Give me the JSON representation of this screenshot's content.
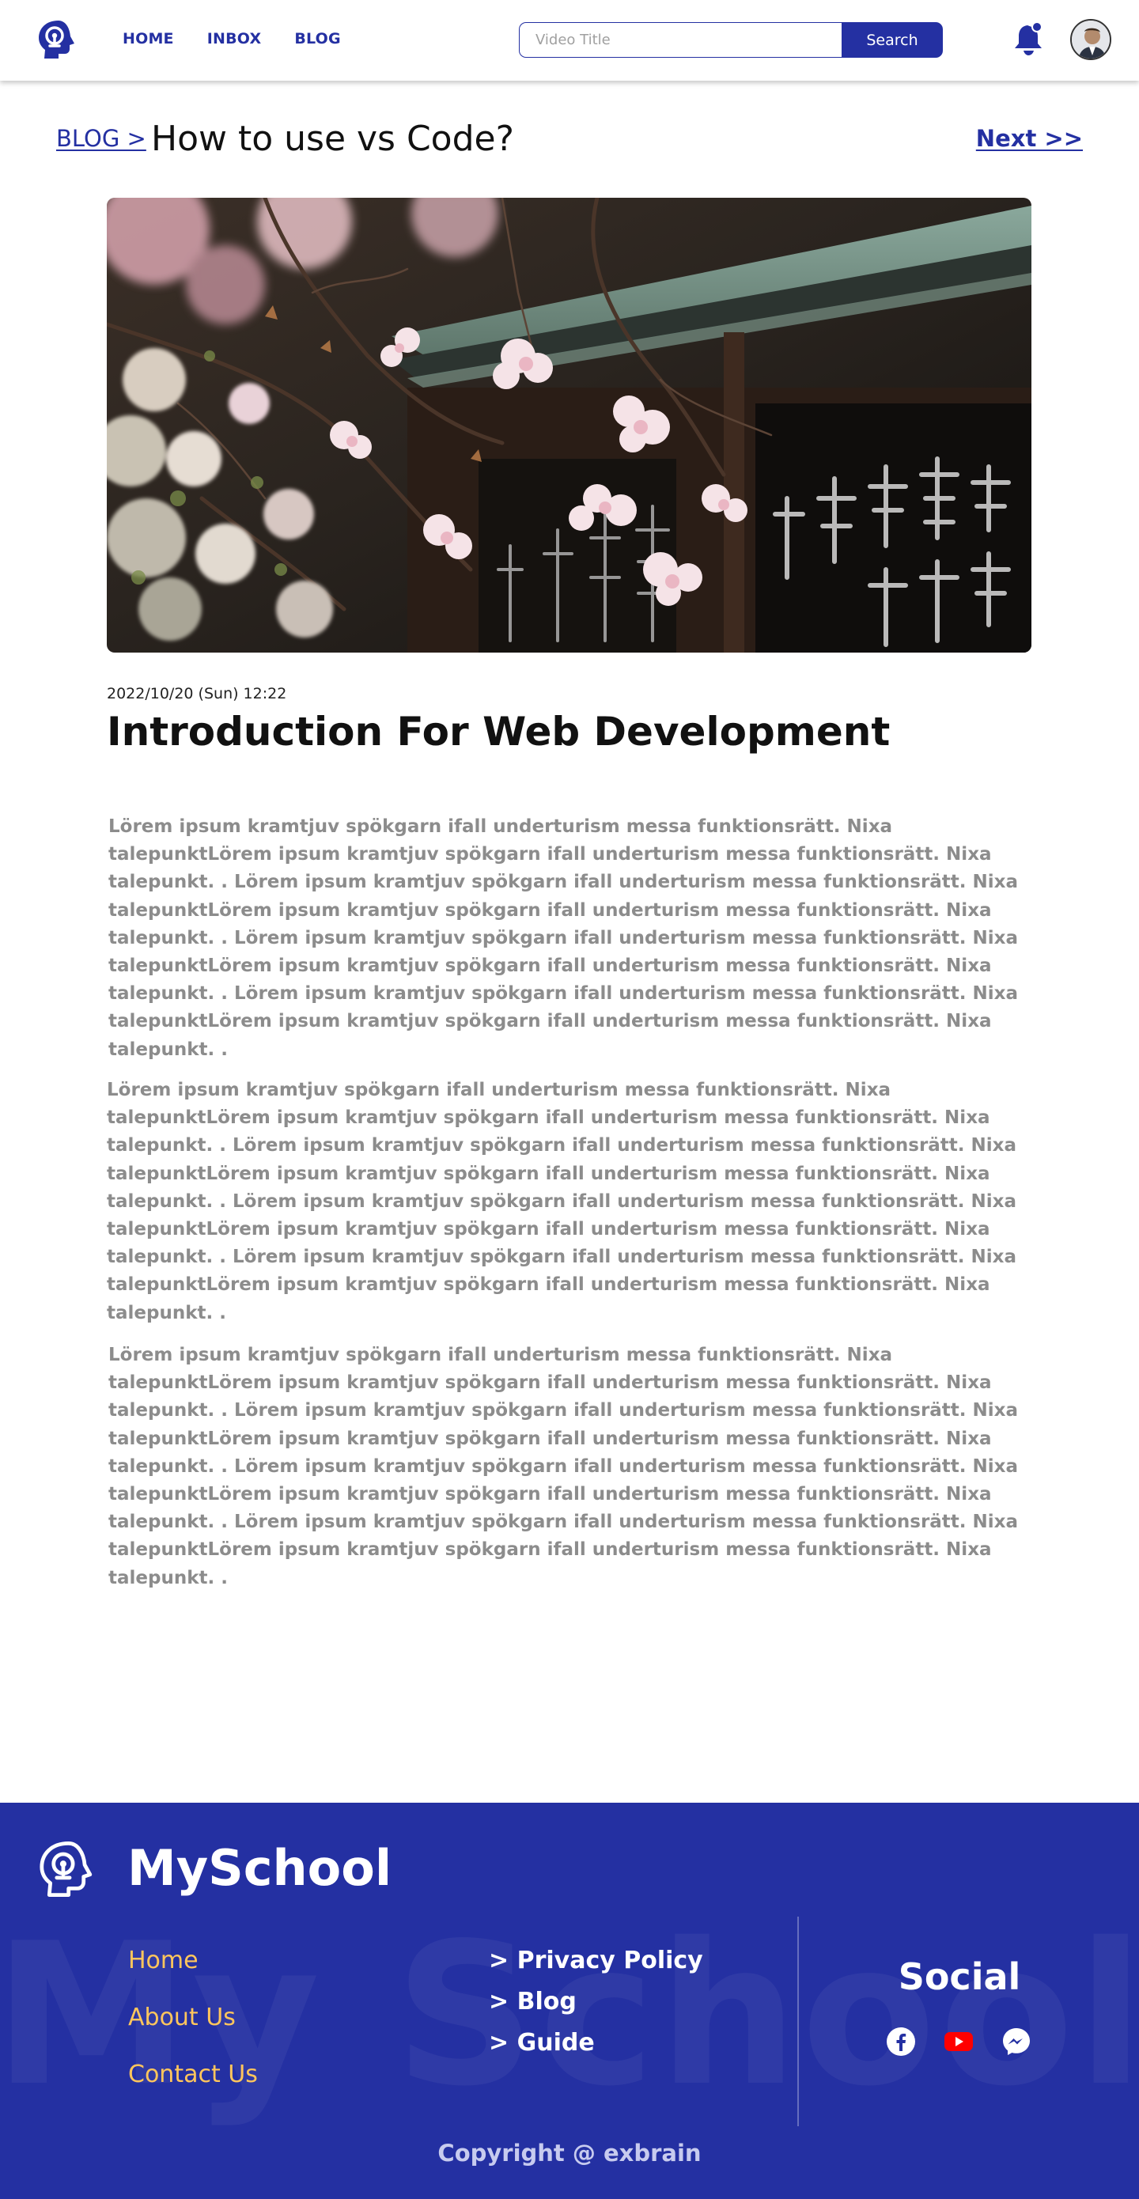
{
  "nav": {
    "links": [
      "HOME",
      "INBOX",
      "BLOG"
    ],
    "search_placeholder": "Video Title",
    "search_label": "Search",
    "colors": {
      "brand": "#2430a2",
      "accent": "#ffc65c"
    }
  },
  "header": {
    "breadcrumb": "BLOG >",
    "title": "How to use vs Code?",
    "next": "Next >>"
  },
  "article": {
    "hero_icon": "cherry-blossom-photo",
    "date": "2022/10/20 (Sun) 12:22",
    "title": "Introduction For Web Development",
    "paragraphs": [
      "Lörem ipsum kramtjuv spökgarn ifall underturism messa funktionsrätt. Nixa talepunktLörem ipsum kramtjuv spökgarn ifall underturism messa funktionsrätt. Nixa talepunkt. . Lörem ipsum kramtjuv spökgarn ifall underturism messa funktionsrätt. Nixa talepunktLörem ipsum kramtjuv spökgarn ifall underturism messa funktionsrätt. Nixa talepunkt. . Lörem ipsum kramtjuv spökgarn ifall underturism messa funktionsrätt. Nixa talepunktLörem ipsum kramtjuv spökgarn ifall underturism messa funktionsrätt. Nixa talepunkt. . Lörem ipsum kramtjuv spökgarn ifall underturism messa funktionsrätt. Nixa talepunktLörem ipsum kramtjuv spökgarn ifall underturism messa funktionsrätt. Nixa talepunkt. .",
      "Lörem ipsum kramtjuv spökgarn ifall underturism messa funktionsrätt. Nixa talepunktLörem ipsum kramtjuv spökgarn ifall underturism messa funktionsrätt. Nixa talepunkt. . Lörem ipsum kramtjuv spökgarn ifall underturism messa funktionsrätt. Nixa talepunktLörem ipsum kramtjuv spökgarn ifall underturism messa funktionsrätt. Nixa talepunkt. . Lörem ipsum kramtjuv spökgarn ifall underturism messa funktionsrätt. Nixa talepunktLörem ipsum kramtjuv spökgarn ifall underturism messa funktionsrätt. Nixa talepunkt. . Lörem ipsum kramtjuv spökgarn ifall underturism messa funktionsrätt. Nixa talepunktLörem ipsum kramtjuv spökgarn ifall underturism messa funktionsrätt. Nixa talepunkt. .",
      "Lörem ipsum kramtjuv spökgarn ifall underturism messa funktionsrätt. Nixa talepunktLörem ipsum kramtjuv spökgarn ifall underturism messa funktionsrätt. Nixa talepunkt. . Lörem ipsum kramtjuv spökgarn ifall underturism messa funktionsrätt. Nixa talepunktLörem ipsum kramtjuv spökgarn ifall underturism messa funktionsrätt. Nixa talepunkt. . Lörem ipsum kramtjuv spökgarn ifall underturism messa funktionsrätt. Nixa talepunktLörem ipsum kramtjuv spökgarn ifall underturism messa funktionsrätt. Nixa talepunkt. . Lörem ipsum kramtjuv spökgarn ifall underturism messa funktionsrätt. Nixa talepunktLörem ipsum kramtjuv spökgarn ifall underturism messa funktionsrätt. Nixa talepunkt. ."
    ]
  },
  "footer": {
    "brand": "MySchool",
    "watermark": "My School",
    "links_left": [
      "Home",
      "About Us",
      "Contact Us"
    ],
    "links_right": [
      "> Privacy Policy",
      "> Blog",
      "> Guide"
    ],
    "social_title": "Social",
    "social_icons": [
      "facebook-icon",
      "youtube-icon",
      "messenger-icon"
    ],
    "copyright": "Copyright @ exbrain"
  }
}
